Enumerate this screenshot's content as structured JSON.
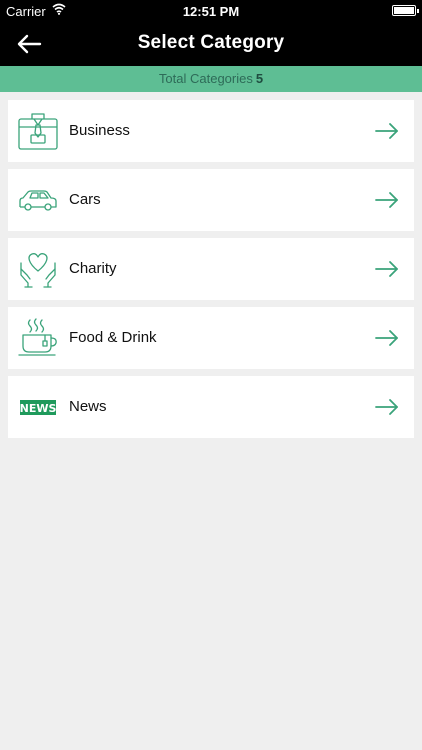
{
  "status_bar": {
    "carrier": "Carrier",
    "time": "12:51 PM"
  },
  "nav": {
    "title": "Select Category",
    "back_icon": "arrow-left-icon"
  },
  "summary": {
    "label": "Total Categories",
    "count": "5"
  },
  "categories": [
    {
      "label": "Business",
      "icon": "briefcase-icon"
    },
    {
      "label": "Cars",
      "icon": "car-icon"
    },
    {
      "label": "Charity",
      "icon": "heart-hands-icon"
    },
    {
      "label": "Food & Drink",
      "icon": "coffee-cup-icon"
    },
    {
      "label": "News",
      "icon": "news-icon"
    }
  ],
  "colors": {
    "accent": "#5ebe94",
    "icon_stroke": "#3aa37a",
    "header_bg": "#000000",
    "page_bg": "#efefef"
  }
}
